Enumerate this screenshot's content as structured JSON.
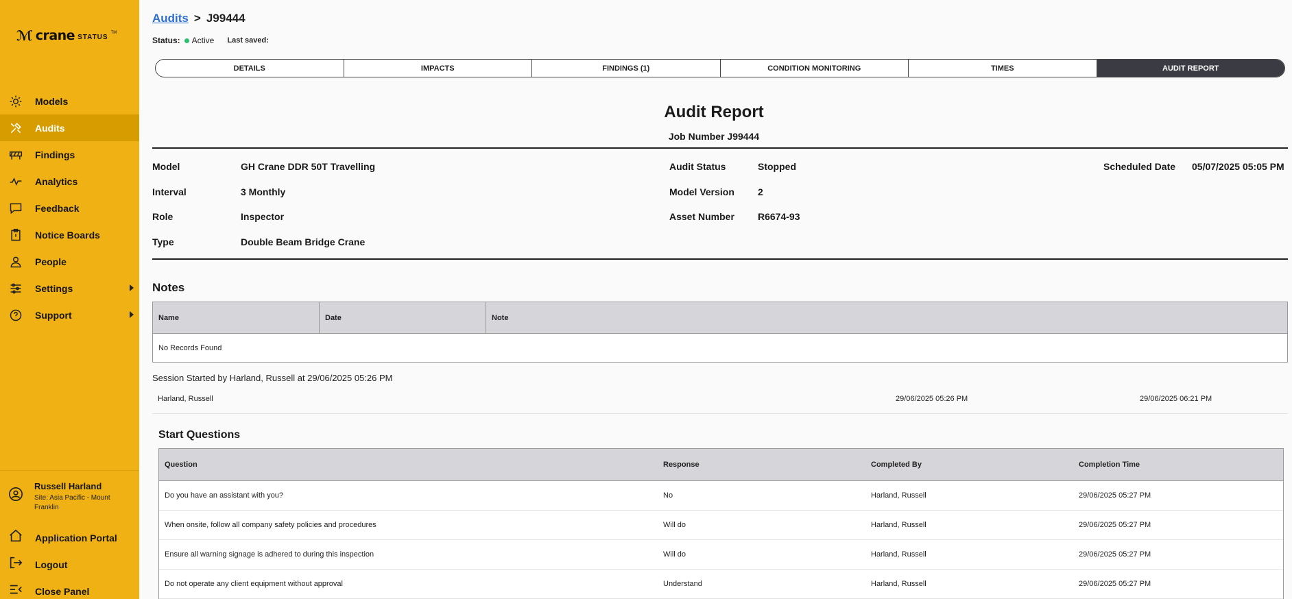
{
  "brand": {
    "mark": "ℳ",
    "word": "crane",
    "sub": "STATUS",
    "tm": "TM"
  },
  "nav": [
    {
      "label": "Models",
      "icon": "gear-icon",
      "active": false
    },
    {
      "label": "Audits",
      "icon": "tools-icon",
      "active": true
    },
    {
      "label": "Findings",
      "icon": "barrier-icon",
      "active": false
    },
    {
      "label": "Analytics",
      "icon": "pulse-icon",
      "active": false
    },
    {
      "label": "Feedback",
      "icon": "chat-icon",
      "active": false
    },
    {
      "label": "Notice Boards",
      "icon": "clipboard-icon",
      "active": false
    },
    {
      "label": "People",
      "icon": "person-icon",
      "active": false
    },
    {
      "label": "Settings",
      "icon": "sliders-icon",
      "active": false
    },
    {
      "label": "Support",
      "icon": "help-icon",
      "active": false
    }
  ],
  "user": {
    "name": "Russell Harland",
    "site": "Site: Asia Pacific - Mount Franklin"
  },
  "bottom_nav": [
    {
      "label": "Application Portal",
      "icon": "home-icon"
    },
    {
      "label": "Logout",
      "icon": "logout-icon"
    },
    {
      "label": "Close Panel",
      "icon": "collapse-icon"
    }
  ],
  "breadcrumb": {
    "root": "Audits",
    "sep": ">",
    "current": "J99444"
  },
  "status": {
    "label": "Status:",
    "value": "Active",
    "saved_label": "Last saved:",
    "dot_color": "#2fbf71"
  },
  "tabs": [
    "DETAILS",
    "IMPACTS",
    "FINDINGS (1)",
    "CONDITION MONITORING",
    "TIMES",
    "AUDIT REPORT"
  ],
  "report": {
    "title": "Audit Report",
    "job": "Job Number J99444",
    "left": [
      {
        "k": "Model",
        "v": "GH Crane DDR 50T Travelling"
      },
      {
        "k": "Interval",
        "v": "3 Monthly"
      },
      {
        "k": "Role",
        "v": "Inspector"
      },
      {
        "k": "Type",
        "v": "Double Beam Bridge Crane"
      }
    ],
    "mid": [
      {
        "k": "Audit Status",
        "v": "Stopped"
      },
      {
        "k": "Model Version",
        "v": "2"
      },
      {
        "k": "Asset Number",
        "v": "R6674-93"
      }
    ],
    "right": [
      {
        "k": "Scheduled Date",
        "v": "05/07/2025 05:05 PM"
      }
    ]
  },
  "notes": {
    "title": "Notes",
    "headers": [
      "Name",
      "Date",
      "Note"
    ],
    "empty": "No Records Found"
  },
  "session": {
    "text": "Session Started by Harland, Russell at 29/06/2025 05:26 PM",
    "name": "Harland, Russell",
    "start": "29/06/2025 05:26 PM",
    "end": "29/06/2025 06:21 PM"
  },
  "start_questions": {
    "title": "Start Questions",
    "headers": [
      "Question",
      "Response",
      "Completed By",
      "Completion Time"
    ],
    "rows": [
      [
        "Do you have an assistant with you?",
        "No",
        "Harland, Russell",
        "29/06/2025 05:27 PM"
      ],
      [
        "When onsite, follow all company safety policies and procedures",
        "Will do",
        "Harland, Russell",
        "29/06/2025 05:27 PM"
      ],
      [
        "Ensure all warning signage is adhered to during this inspection",
        "Will do",
        "Harland, Russell",
        "29/06/2025 05:27 PM"
      ],
      [
        "Do not operate any client equipment without approval",
        "Understand",
        "Harland, Russell",
        "29/06/2025 05:27 PM"
      ]
    ]
  }
}
